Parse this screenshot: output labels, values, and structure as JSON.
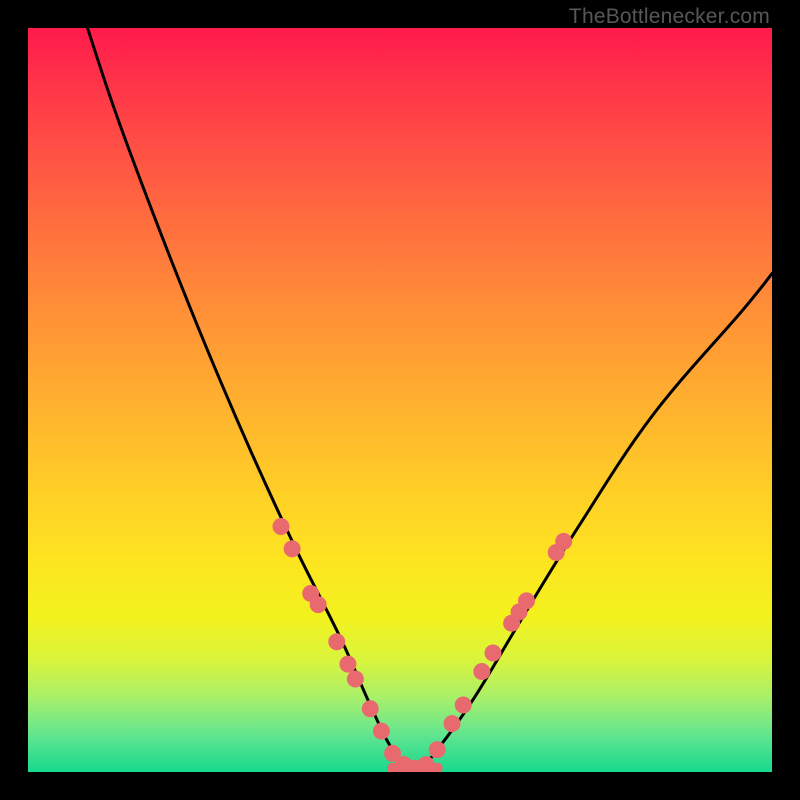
{
  "credit": "TheBottlenecker.com",
  "chart_data": {
    "type": "line",
    "title": "",
    "xlabel": "",
    "ylabel": "",
    "xlim": [
      0,
      100
    ],
    "ylim": [
      0,
      100
    ],
    "series": [
      {
        "name": "bottleneck-curve",
        "x": [
          8,
          12,
          18,
          24,
          30,
          36,
          42,
          46,
          49,
          52,
          55,
          60,
          66,
          74,
          84,
          96,
          100
        ],
        "y": [
          100,
          88,
          72,
          57,
          43,
          30,
          18,
          9,
          3,
          0,
          3,
          10,
          20,
          33,
          48,
          62,
          67
        ]
      }
    ],
    "markers": {
      "name": "highlight-dots",
      "color": "#e86a6f",
      "points": [
        {
          "x": 34.0,
          "y": 33.0
        },
        {
          "x": 35.5,
          "y": 30.0
        },
        {
          "x": 38.0,
          "y": 24.0
        },
        {
          "x": 39.0,
          "y": 22.5
        },
        {
          "x": 41.5,
          "y": 17.5
        },
        {
          "x": 43.0,
          "y": 14.5
        },
        {
          "x": 44.0,
          "y": 12.5
        },
        {
          "x": 46.0,
          "y": 8.5
        },
        {
          "x": 47.5,
          "y": 5.5
        },
        {
          "x": 49.0,
          "y": 2.5
        },
        {
          "x": 50.5,
          "y": 1.0
        },
        {
          "x": 52.0,
          "y": 0.5
        },
        {
          "x": 53.5,
          "y": 1.0
        },
        {
          "x": 55.0,
          "y": 3.0
        },
        {
          "x": 57.0,
          "y": 6.5
        },
        {
          "x": 58.5,
          "y": 9.0
        },
        {
          "x": 61.0,
          "y": 13.5
        },
        {
          "x": 62.5,
          "y": 16.0
        },
        {
          "x": 65.0,
          "y": 20.0
        },
        {
          "x": 66.0,
          "y": 21.5
        },
        {
          "x": 67.0,
          "y": 23.0
        },
        {
          "x": 71.0,
          "y": 29.5
        },
        {
          "x": 72.0,
          "y": 31.0
        }
      ]
    },
    "flat_segment": {
      "x0": 49,
      "x1": 55,
      "y": 0.5
    }
  }
}
